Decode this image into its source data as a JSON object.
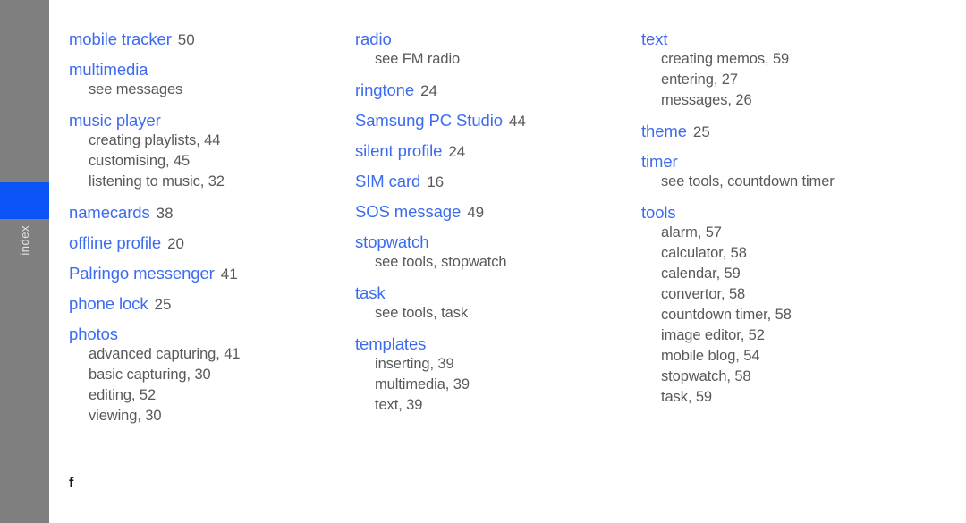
{
  "sidebar": {
    "label": "index",
    "bar_color": "#7f7f7f",
    "tab_color": "#0a53f5",
    "label_color": "#e2e2e2"
  },
  "page": {
    "footer_mark": "f",
    "term_color": "#3c6bf0",
    "text_color": "#58595b"
  },
  "columns": [
    {
      "entries": [
        {
          "term": "mobile tracker",
          "page": "50",
          "subentries": []
        },
        {
          "term": "multimedia",
          "page": "",
          "subentries": [
            "see messages"
          ]
        },
        {
          "term": "music player",
          "page": "",
          "subentries": [
            "creating playlists,  44",
            "customising,  45",
            "listening to music,  32"
          ]
        },
        {
          "term": "namecards",
          "page": "38",
          "subentries": []
        },
        {
          "term": "offline profile",
          "page": "20",
          "subentries": []
        },
        {
          "term": "Palringo messenger",
          "page": "41",
          "subentries": []
        },
        {
          "term": "phone lock",
          "page": "25",
          "subentries": []
        },
        {
          "term": "photos",
          "page": "",
          "subentries": [
            "advanced capturing,  41",
            "basic capturing,  30",
            "editing,  52",
            "viewing,  30"
          ]
        }
      ]
    },
    {
      "entries": [
        {
          "term": "radio",
          "page": "",
          "subentries": [
            "see FM radio"
          ]
        },
        {
          "term": "ringtone",
          "page": "24",
          "subentries": []
        },
        {
          "term": "Samsung PC Studio",
          "page": "44",
          "subentries": []
        },
        {
          "term": "silent profile",
          "page": "24",
          "subentries": []
        },
        {
          "term": "SIM card",
          "page": "16",
          "subentries": []
        },
        {
          "term": "SOS message",
          "page": "49",
          "subentries": []
        },
        {
          "term": "stopwatch",
          "page": "",
          "subentries": [
            "see tools, stopwatch"
          ]
        },
        {
          "term": "task",
          "page": "",
          "subentries": [
            "see tools, task"
          ]
        },
        {
          "term": "templates",
          "page": "",
          "subentries": [
            "inserting,  39",
            "multimedia,  39",
            "text,  39"
          ]
        }
      ]
    },
    {
      "entries": [
        {
          "term": "text",
          "page": "",
          "subentries": [
            "creating memos,  59",
            "entering,  27",
            "messages,  26"
          ]
        },
        {
          "term": "theme",
          "page": "25",
          "subentries": []
        },
        {
          "term": "timer",
          "page": "",
          "subentries": [
            "see tools, countdown timer"
          ]
        },
        {
          "term": "tools",
          "page": "",
          "subentries": [
            "alarm,  57",
            "calculator,  58",
            "calendar,  59",
            "convertor,  58",
            "countdown timer,  58",
            "image editor,  52",
            "mobile blog,  54",
            "stopwatch,  58",
            "task,  59"
          ]
        }
      ]
    }
  ]
}
